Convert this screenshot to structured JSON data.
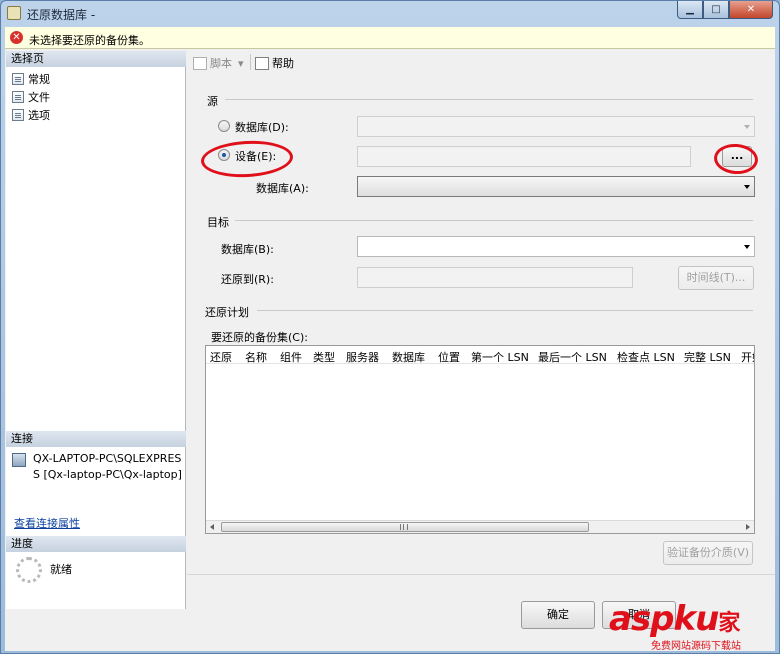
{
  "window": {
    "title": "还原数据库 -",
    "minimize": "▁",
    "maximize": "□",
    "close": "✕"
  },
  "error_bar": {
    "icon": "error-icon",
    "text": "未选择要还原的备份集。"
  },
  "left_pane": {
    "pages_header": "选择页",
    "pages": [
      {
        "label": "常规"
      },
      {
        "label": "文件"
      },
      {
        "label": "选项"
      }
    ],
    "connection_header": "连接",
    "connection_server": "QX-LAPTOP-PC\\SQLEXPRES",
    "connection_server_cont": "S [Qx-laptop-PC\\Qx-laptop]",
    "connection_link": "查看连接属性",
    "progress_header": "进度",
    "progress_status": "就绪"
  },
  "toolbar": {
    "script_label": "脚本",
    "script_arrow": "▾",
    "help_label": "帮助"
  },
  "source": {
    "group_label": "源",
    "database_radio_label": "数据库(D):",
    "device_radio_label": "设备(E):",
    "browse_button_label": "...",
    "database_combo_label": "数据库(A):",
    "selected_option": "device"
  },
  "destination": {
    "group_label": "目标",
    "database_label": "数据库(B):",
    "restore_to_label": "还原到(R):",
    "timeline_button_label": "时间线(T)..."
  },
  "plan": {
    "group_label": "还原计划",
    "backup_sets_label": "要还原的备份集(C):",
    "columns": [
      "还原",
      "名称",
      "组件",
      "类型",
      "服务器",
      "数据库",
      "位置",
      "第一个 LSN",
      "最后一个 LSN",
      "检查点 LSN",
      "完整 LSN",
      "开始"
    ],
    "verify_button_label": "验证备份介质(V)"
  },
  "footer": {
    "ok_button_label": "确定",
    "cancel_button_label": "取消"
  },
  "watermark": {
    "brand": "aspku",
    "suffix": "家",
    "tagline": "免费网站源码下载站"
  },
  "colors": {
    "annotation": "#e0101b",
    "error": "#d8312b",
    "link": "#0b3fa0"
  }
}
